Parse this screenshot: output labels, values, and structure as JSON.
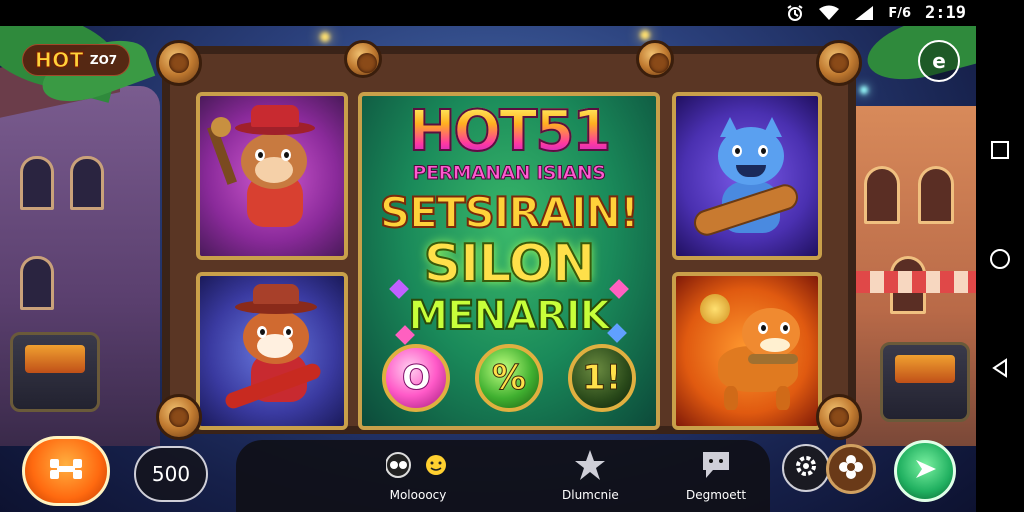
{
  "status_bar": {
    "time": "2:19",
    "battery_label": "F/6",
    "icons": [
      "alarm-icon",
      "wifi-icon",
      "signal-icon",
      "battery-icon"
    ]
  },
  "nav_bar": {
    "icons": [
      "recents-square-icon",
      "home-circle-icon",
      "back-triangle-icon"
    ]
  },
  "hud": {
    "hot_badge": {
      "hot": "HOT",
      "sub": "ZO7"
    },
    "profile_icon": "e"
  },
  "title": {
    "game_title": "HOT51",
    "subtitle": "PERMANAN ISIANS",
    "line1": "SETSIRAIN!",
    "line2": "SILON",
    "line3": "MENARIK"
  },
  "coins": [
    {
      "label": "O"
    },
    {
      "label": "%"
    },
    {
      "label": "1!"
    }
  ],
  "bottom_bar": {
    "bet_value": "500",
    "tabs": [
      {
        "label": "Molooocy",
        "icon": "eyes-smile-icon"
      },
      {
        "label": "Dlumcnie",
        "icon": "star-icon"
      },
      {
        "label": "Degmoett",
        "icon": "chat-bubble-icon"
      }
    ]
  },
  "colors": {
    "accent_orange": "#ff6a10",
    "accent_green": "#20b060",
    "frame_gold": "#c9a04a",
    "wood": "#5a3624"
  }
}
